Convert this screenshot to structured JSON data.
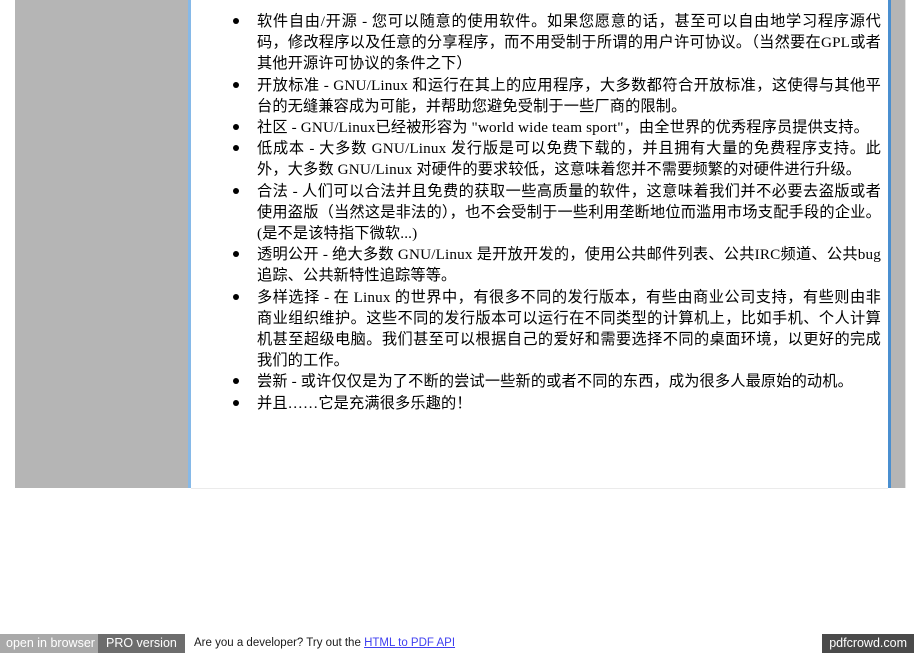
{
  "document": {
    "bullets": [
      {
        "id": "software-freedom",
        "text": "软件自由/开源 - 您可以随意的使用软件。如果您愿意的话，甚至可以自由地学习程序源代码，修改程序以及任意的分享程序，而不用受制于所谓的用户许可协议。（当然要在GPL或者其他开源许可协议的条件之下）"
      },
      {
        "id": "open-standards",
        "text": "开放标准 - GNU/Linux 和运行在其上的应用程序，大多数都符合开放标准，这使得与其他平台的无缝兼容成为可能，并帮助您避免受制于一些厂商的限制。"
      },
      {
        "id": "community",
        "text": "社区 - GNU/Linux已经被形容为 \"world wide team sport\"，由全世界的优秀程序员提供支持。"
      },
      {
        "id": "low-cost",
        "text": "低成本 - 大多数 GNU/Linux 发行版是可以免费下载的，并且拥有大量的免费程序支持。此外，大多数 GNU/Linux 对硬件的要求较低，这意味着您并不需要频繁的对硬件进行升级。"
      },
      {
        "id": "legal",
        "text": "合法 - 人们可以合法并且免费的获取一些高质量的软件，这意味着我们并不必要去盗版或者使用盗版（当然这是非法的），也不会受制于一些利用垄断地位而滥用市场支配手段的企业。(是不是该特指下微软...)"
      },
      {
        "id": "transparency",
        "text": "透明公开 - 绝大多数 GNU/Linux 是开放开发的，使用公共邮件列表、公共IRC频道、公共bug追踪、公共新特性追踪等等。"
      },
      {
        "id": "diverse-choice",
        "text": "多样选择 - 在 Linux 的世界中，有很多不同的发行版本，有些由商业公司支持，有些则由非商业组织维护。这些不同的发行版本可以运行在不同类型的计算机上，比如手机、个人计算机甚至超级电脑。我们甚至可以根据自己的爱好和需要选择不同的桌面环境，以更好的完成我们的工作。"
      },
      {
        "id": "try-new",
        "text": "尝新 - 或许仅仅是为了不断的尝试一些新的或者不同的东西，成为很多人最原始的动机。"
      },
      {
        "id": "and-fun",
        "text": "并且……它是充满很多乐趣的！"
      }
    ]
  },
  "bottom_bar": {
    "open_in_browser": "open in browser",
    "pro_version": "PRO version",
    "developer_text": "Are you a developer? Try out the",
    "api_link": "HTML to PDF API",
    "watermark": "pdfcrowd.com"
  },
  "colors": {
    "margin_gray": "#b5b5b5",
    "left_divider_blue": "#86b9e8",
    "right_divider_blue": "#4a8fd0",
    "link_blue": "#4040f0",
    "pro_badge": "#6d6d6d",
    "open_badge": "#a9a9a9",
    "watermark_badge": "#4a4a4a"
  }
}
